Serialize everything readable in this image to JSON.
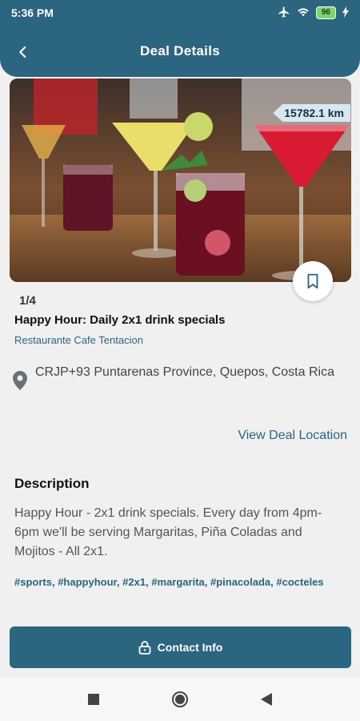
{
  "status": {
    "time": "5:36 PM",
    "battery": "96"
  },
  "header": {
    "title": "Deal Details"
  },
  "deal": {
    "distance": "15782.1 km",
    "pager": "1/4",
    "title": "Happy Hour: Daily 2x1 drink specials",
    "venue": "Restaurante Cafe Tentacion",
    "address": "CRJP+93 Puntarenas Province, Quepos, Costa Rica",
    "view_location": "View Deal Location"
  },
  "description": {
    "heading": "Description",
    "text": "Happy Hour - 2x1 drink specials.  Every day from 4pm-6pm we'll be serving Margaritas, Piña Coladas and Mojitos - All 2x1."
  },
  "tags": [
    "#sports",
    "#happyhour",
    "#2x1",
    "#margarita",
    "#pinacolada",
    "#cocteles"
  ],
  "footer": {
    "contact_label": "Contact Info"
  },
  "colors": {
    "primary": "#2b6580",
    "background": "#f0f0f0",
    "badge": "#d6e9f3"
  },
  "icons": {
    "back": "arrow-left-icon",
    "bookmark": "bookmark-icon",
    "pin": "location-pin-icon",
    "lock": "lock-icon",
    "airplane": "airplane-icon",
    "wifi": "wifi-icon"
  }
}
